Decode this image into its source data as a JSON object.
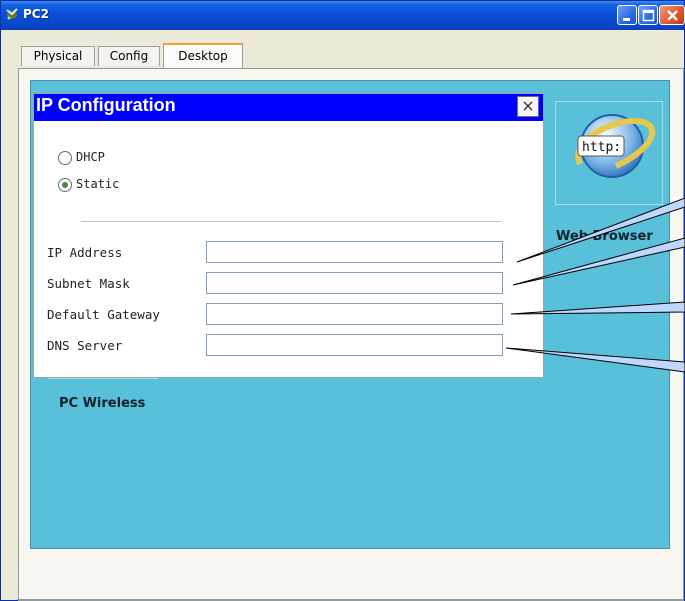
{
  "window": {
    "title": "PC2",
    "controls": [
      "minimize",
      "maximize",
      "close"
    ]
  },
  "tabs": [
    {
      "label": "Physical",
      "active": false
    },
    {
      "label": "Config",
      "active": false
    },
    {
      "label": "Desktop",
      "active": true
    }
  ],
  "desktop": {
    "apps": [
      {
        "label": "Web Browser",
        "icon": "web-browser-icon",
        "badge": "http:"
      },
      {
        "label": "PC Wireless",
        "icon": "pc-wireless-icon"
      }
    ]
  },
  "ip_config": {
    "title": "IP Configuration",
    "close_label": "×",
    "mode_options": [
      {
        "label": "DHCP",
        "selected": false
      },
      {
        "label": "Static",
        "selected": true
      }
    ],
    "fields": [
      {
        "label": "IP Address",
        "value": ""
      },
      {
        "label": "Subnet Mask",
        "value": ""
      },
      {
        "label": "Default Gateway",
        "value": ""
      },
      {
        "label": "DNS Server",
        "value": ""
      }
    ]
  },
  "colors": {
    "titlebar": "#0a4ed8",
    "dialog_title": "#0000ff",
    "desktop_bg": "#58c0d8",
    "callout_fill": "#bfd7ff"
  }
}
